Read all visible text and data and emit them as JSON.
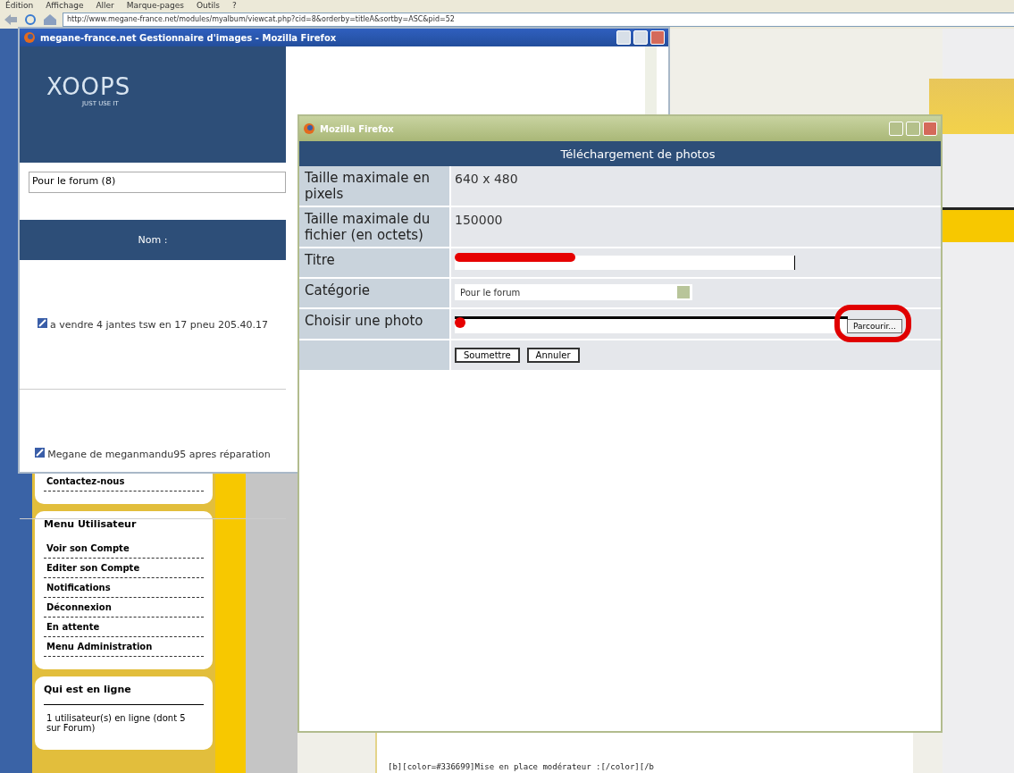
{
  "browser": {
    "menu": [
      "Édition",
      "Affichage",
      "Aller",
      "Marque-pages",
      "Outils",
      "?"
    ],
    "address": "http://www.megane-france.net/modules/myalbum/viewcat.php?cid=8&orderby=titleA&sortby=ASC&pid=52"
  },
  "page": {
    "sidebar": [
      {
        "items": [
          "Contactez-nous"
        ]
      },
      {
        "title": "Menu Utilisateur",
        "items": [
          "Voir son Compte",
          "Editer son Compte",
          "Notifications",
          "Déconnexion",
          "En attente",
          "Menu Administration"
        ]
      },
      {
        "title": "Qui est en ligne",
        "items": [
          "1 utilisateur(s) en ligne (dont 5 sur Forum)"
        ]
      }
    ],
    "content_text": "[b][color=#336699]Mise en place modérateur :[/color][/b"
  },
  "image_manager": {
    "title": "megane-france.net Gestionnaire d'images - Mozilla Firefox",
    "logo": "XOOPS",
    "logo_tagline": "JUST USE IT",
    "category": "Pour le forum (8)",
    "column_header": "Nom :",
    "images": [
      {
        "name": "a vendre 4 jantes tsw en 17 pneu 205.40.17"
      },
      {
        "name": "Megane de meganmandu95 apres réparation"
      }
    ]
  },
  "upload_dialog": {
    "title": "Mozilla Firefox",
    "header": "Téléchargement de photos",
    "rows": [
      {
        "kind": "text",
        "label": "Taille maximale en pixels",
        "value": "640 x 480"
      },
      {
        "kind": "text",
        "label": "Taille maximale du fichier (en octets)",
        "value": "150000"
      },
      {
        "kind": "input",
        "label": "Titre",
        "redacted": true
      },
      {
        "kind": "select",
        "label": "Catégorie",
        "value": "Pour le forum"
      },
      {
        "kind": "file",
        "label": "Choisir une photo",
        "redacted": true,
        "button": "Parcourir...",
        "highlighted": true
      }
    ],
    "buttons": [
      "Soumettre",
      "Annuler"
    ]
  }
}
